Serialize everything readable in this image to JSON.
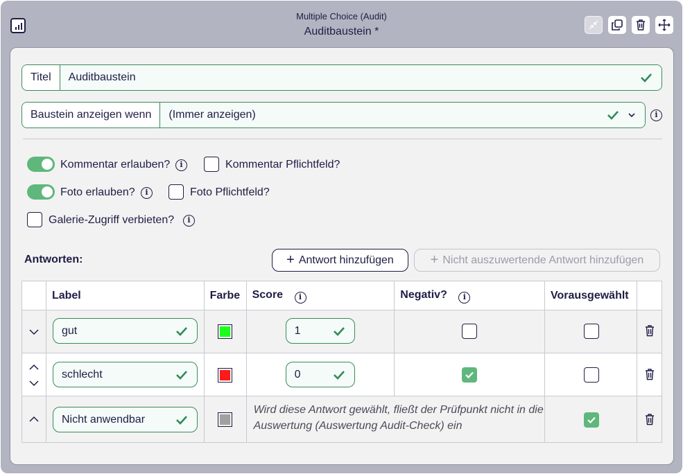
{
  "header": {
    "subtitle": "Multiple Choice (Audit)",
    "title": "Auditbaustein *"
  },
  "form": {
    "title_label": "Titel",
    "title_value": "Auditbaustein",
    "condition_label": "Baustein anzeigen wenn",
    "condition_value": "(Immer anzeigen)"
  },
  "options": {
    "comment_allowed": {
      "label": "Kommentar erlauben?",
      "on": true
    },
    "comment_required": {
      "label": "Kommentar Pflichtfeld?",
      "checked": false
    },
    "photo_allowed": {
      "label": "Foto erlauben?",
      "on": true
    },
    "photo_required": {
      "label": "Foto Pflichtfeld?",
      "checked": false
    },
    "gallery_forbidden": {
      "label": "Galerie-Zugriff verbieten?",
      "checked": false
    }
  },
  "answers": {
    "title": "Antworten:",
    "add_button": "Antwort hinzufügen",
    "add_nonscored_button": "Nicht auszuwertende Antwort hinzufügen",
    "columns": [
      "Label",
      "Farbe",
      "Score",
      "Negativ?",
      "Vorausgewählt"
    ],
    "rows": [
      {
        "label": "gut",
        "color": "#1aff1a",
        "score": "1",
        "negative": false,
        "preselected": false
      },
      {
        "label": "schlecht",
        "color": "#ff1a1a",
        "score": "0",
        "negative": true,
        "preselected": false
      },
      {
        "label": "Nicht anwendbar",
        "color": "#a0a0a0",
        "note": "Wird diese Antwort gewählt, fließt der Prüfpunkt nicht in die Auswertung (Auswertung Audit-Check) ein",
        "preselected": true
      }
    ]
  },
  "colors": {
    "accent_green": "#5fb77c",
    "check_green": "#2e8b57",
    "text_dark": "#1f1d45"
  }
}
